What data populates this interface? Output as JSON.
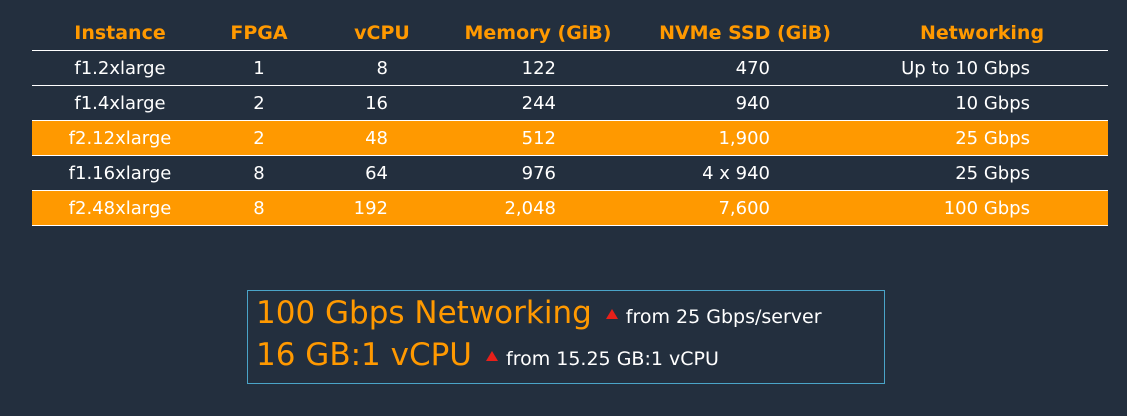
{
  "table": {
    "headers": [
      "Instance",
      "FPGA",
      "vCPU",
      "Memory (GiB)",
      "NVMe SSD (GiB)",
      "Networking"
    ],
    "rows": [
      {
        "instance": "f1.2xlarge",
        "fpga": "1",
        "vcpu": "8",
        "memory": "122",
        "nvme": "470",
        "networking": "Up to 10 Gbps",
        "highlighted": false
      },
      {
        "instance": "f1.4xlarge",
        "fpga": "2",
        "vcpu": "16",
        "memory": "244",
        "nvme": "940",
        "networking": "10 Gbps",
        "highlighted": false
      },
      {
        "instance": "f2.12xlarge",
        "fpga": "2",
        "vcpu": "48",
        "memory": "512",
        "nvme": "1,900",
        "networking": "25 Gbps",
        "highlighted": true
      },
      {
        "instance": "f1.16xlarge",
        "fpga": "8",
        "vcpu": "64",
        "memory": "976",
        "nvme": "4 x 940",
        "networking": "25 Gbps",
        "highlighted": false
      },
      {
        "instance": "f2.48xlarge",
        "fpga": "8",
        "vcpu": "192",
        "memory": "2,048",
        "nvme": "7,600",
        "networking": "100 Gbps",
        "highlighted": true
      }
    ]
  },
  "callout": {
    "line1": {
      "headline": "100 Gbps Networking",
      "detail": "from 25 Gbps/server",
      "icon": "red-up-triangle"
    },
    "line2": {
      "headline": "16 GB:1 vCPU",
      "detail": "from 15.25 GB:1 vCPU",
      "icon": "red-up-triangle"
    }
  },
  "colors": {
    "background": "#232f3e",
    "accent": "#ff9900",
    "text": "#ffffff",
    "callout_border": "#4aa4c8",
    "arrow": "#e8201a"
  }
}
